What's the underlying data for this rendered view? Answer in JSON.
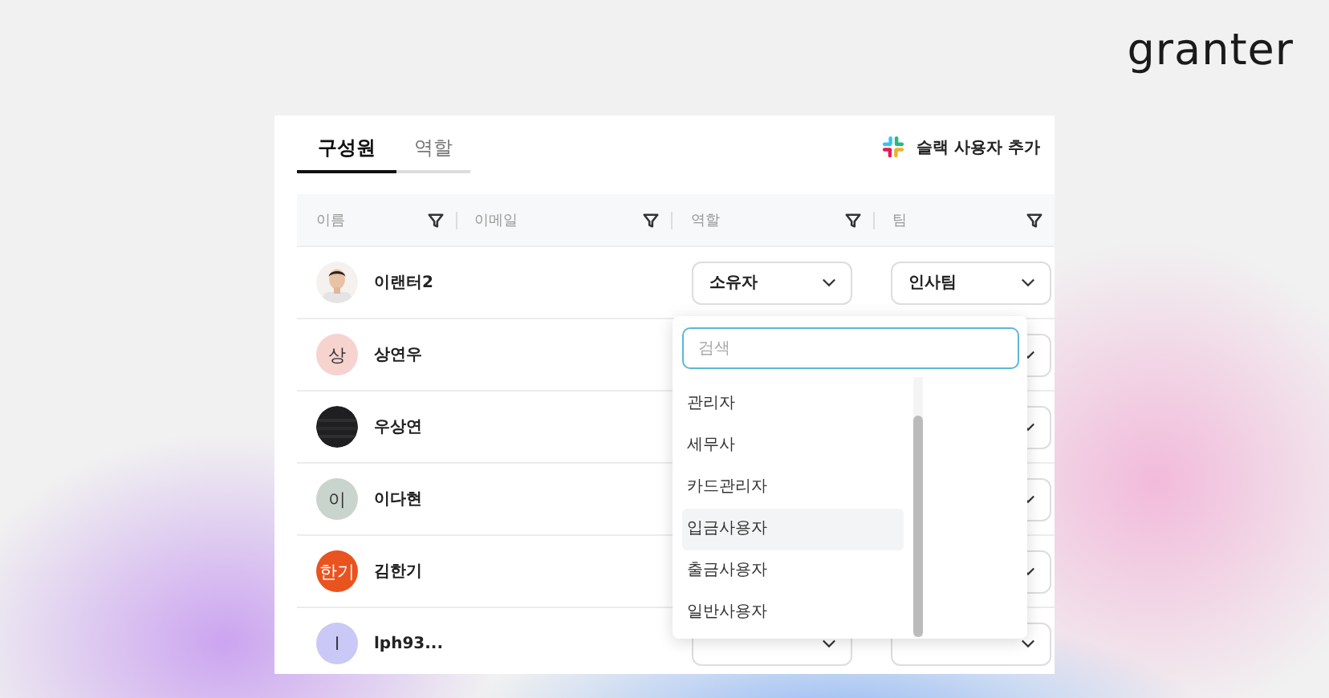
{
  "logo": "granter",
  "tabs": [
    {
      "label": "구성원",
      "selected": true
    },
    {
      "label": "역할",
      "selected": false
    }
  ],
  "slack_button": {
    "label": "슬랙 사용자 추가"
  },
  "table": {
    "columns": [
      "이름",
      "이메일",
      "역할",
      "팀"
    ],
    "rows": [
      {
        "name": "이랜터2",
        "role": "소유자",
        "team": "인사팀"
      },
      {
        "avatar": {
          "kind": "initial",
          "text": "상",
          "color": "#f6d3cf"
        },
        "name": "상연우"
      },
      {
        "name": "우상연"
      },
      {
        "avatar": {
          "kind": "initial",
          "text": "이",
          "color": "#c9d4cd"
        },
        "name": "이다현"
      },
      {
        "avatar": {
          "kind": "initial",
          "text": "한기",
          "color": "#e9531f"
        },
        "name": "김한기"
      },
      {
        "avatar": {
          "kind": "initial",
          "text": "l",
          "color": "#c9c8f6"
        },
        "name": "lph93..."
      }
    ]
  },
  "role_dropdown": {
    "search_placeholder": "검색",
    "options": [
      {
        "label": "관리자",
        "highlighted": false
      },
      {
        "label": "세무사",
        "highlighted": false
      },
      {
        "label": "카드관리자",
        "highlighted": false
      },
      {
        "label": "입금사용자",
        "highlighted": true
      },
      {
        "label": "출금사용자",
        "highlighted": false
      },
      {
        "label": "일반사용자",
        "highlighted": false
      }
    ]
  }
}
